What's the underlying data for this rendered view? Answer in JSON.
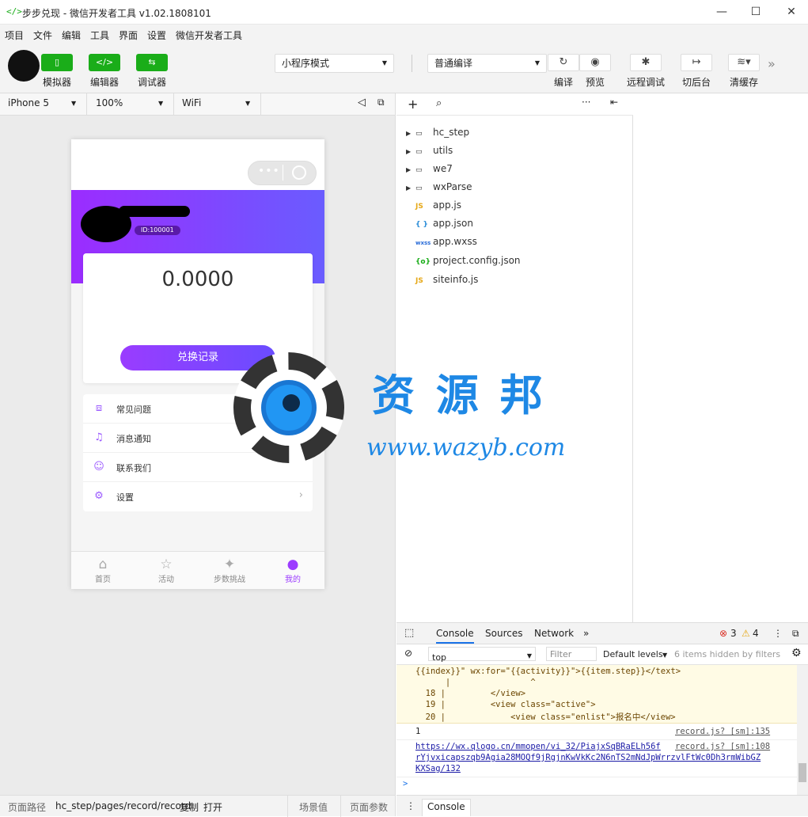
{
  "window": {
    "title": "步步兑现 - 微信开发者工具 v1.02.1808101",
    "controls": {
      "minimize": "—",
      "maximize": "☐",
      "close": "✕"
    }
  },
  "menu": [
    "项目",
    "文件",
    "编辑",
    "工具",
    "界面",
    "设置",
    "微信开发者工具"
  ],
  "toolbar": {
    "simulator": "模拟器",
    "editor": "编辑器",
    "debugger": "调试器",
    "mode": "小程序模式",
    "compile_mode": "普通编译",
    "compile": "编译",
    "preview": "预览",
    "remote_debug": "远程调试",
    "background": "切后台",
    "clear_cache": "清缓存",
    "more": "»"
  },
  "device": {
    "model": "iPhone 5",
    "zoom": "100%",
    "network": "WiFi"
  },
  "phone": {
    "user_id": "ID:100001",
    "balance": "0.0000",
    "exchange_btn": "兑换记录",
    "menu": [
      {
        "label": "常见问题",
        "icon": "faq-icon"
      },
      {
        "label": "消息通知",
        "icon": "bell-icon"
      },
      {
        "label": "联系我们",
        "icon": "contact-icon"
      },
      {
        "label": "设置",
        "icon": "gear-icon"
      }
    ],
    "tabs": [
      {
        "label": "首页",
        "glyph": "⌂"
      },
      {
        "label": "活动",
        "glyph": "☆"
      },
      {
        "label": "步数挑战",
        "glyph": "✦"
      },
      {
        "label": "我的",
        "glyph": "●"
      }
    ],
    "active_tab": "我的",
    "accent": "#9c3cff"
  },
  "files": [
    {
      "name": "hc_step",
      "type": "folder"
    },
    {
      "name": "utils",
      "type": "folder"
    },
    {
      "name": "we7",
      "type": "folder"
    },
    {
      "name": "wxParse",
      "type": "folder"
    },
    {
      "name": "app.js",
      "type": "js",
      "icon": "JS"
    },
    {
      "name": "app.json",
      "type": "json",
      "icon": "{ }"
    },
    {
      "name": "app.wxss",
      "type": "wxss",
      "icon": "wxss"
    },
    {
      "name": "project.config.json",
      "type": "config",
      "icon": "{o}"
    },
    {
      "name": "siteinfo.js",
      "type": "js",
      "icon": "JS"
    }
  ],
  "watermark": {
    "title": "资 源 邦",
    "url": "www.wazyb.com"
  },
  "console": {
    "tabs": [
      "Console",
      "Sources",
      "Network"
    ],
    "errors": "3",
    "warnings": "4",
    "context": "top",
    "filter_placeholder": "Filter",
    "levels": "Default levels",
    "hidden": "6 items hidden by filters",
    "error_lines": [
      "{{index}}\" wx:for=\"{{activity}}\">{{item.step}}</text>",
      "      |                ^",
      "  18 |         </view>",
      "  19 |         <view class=\"active\">",
      "  20 |             <view class=\"enlist\">报名中</view>"
    ],
    "log1": {
      "text": "1",
      "source": "record.js? [sm]:135"
    },
    "log2": {
      "url1": "https://wx.qlogo.cn/mmopen/vi_32/PiajxSqBRaELh56f",
      "url2": "rYjvxicapszqb9Agia28MOQf9jRgjnKwVkKc2N6nTS2mNdJpWrrzvlFtWc0Dh3rmWibGZ",
      "url3": "KXSag/132",
      "source": "record.js? [sm]:108"
    },
    "prompt": ">",
    "drawer_tab": "Console"
  },
  "statusbar": {
    "path_label": "页面路径",
    "path": "hc_step/pages/record/record",
    "copy": "复制",
    "open": "打开",
    "scene": "场景值",
    "params": "页面参数"
  }
}
